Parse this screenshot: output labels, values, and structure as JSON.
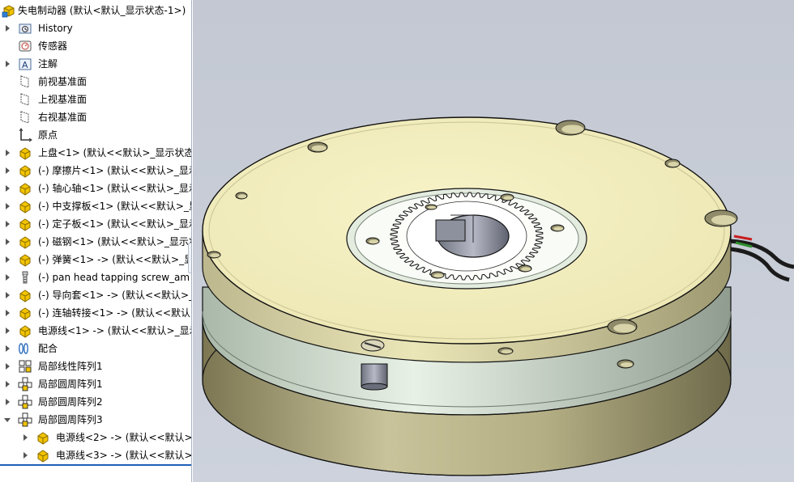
{
  "tree": {
    "root": {
      "label": "失电制动器 (默认<默认_显示状态-1>)",
      "icon": "assembly-icon"
    },
    "items": [
      {
        "label": "History",
        "icon": "history-folder-icon",
        "expander": "right",
        "indent": 0
      },
      {
        "label": "传感器",
        "icon": "sensor-icon",
        "expander": "none",
        "indent": 0
      },
      {
        "label": "注解",
        "icon": "annotation-icon",
        "expander": "right",
        "indent": 0
      },
      {
        "label": "前视基准面",
        "icon": "plane-icon",
        "expander": "none",
        "indent": 0
      },
      {
        "label": "上视基准面",
        "icon": "plane-icon",
        "expander": "none",
        "indent": 0
      },
      {
        "label": "右视基准面",
        "icon": "plane-icon",
        "expander": "none",
        "indent": 0
      },
      {
        "label": "原点",
        "icon": "origin-icon",
        "expander": "none",
        "indent": 0
      },
      {
        "label": "上盘<1> (默认<<默认>_显示状态",
        "icon": "part-icon",
        "expander": "right",
        "indent": 0
      },
      {
        "label": "(-) 摩擦片<1> (默认<<默认>_显示",
        "icon": "part-icon",
        "expander": "right",
        "indent": 0
      },
      {
        "label": "(-) 轴心轴<1> (默认<<默认>_显示",
        "icon": "part-icon",
        "expander": "right",
        "indent": 0
      },
      {
        "label": "(-) 中支撑板<1> (默认<<默认>_显",
        "icon": "part-icon",
        "expander": "right",
        "indent": 0
      },
      {
        "label": "(-) 定子板<1> (默认<<默认>_显示",
        "icon": "part-icon",
        "expander": "right",
        "indent": 0
      },
      {
        "label": "(-) 磁钢<1> (默认<<默认>_显示状",
        "icon": "part-icon",
        "expander": "right",
        "indent": 0
      },
      {
        "label": "(-) 弹簧<1> -> (默认<<默认>_显",
        "icon": "part-icon",
        "expander": "right",
        "indent": 0
      },
      {
        "label": "(-) pan head tapping screw_am",
        "icon": "screw-icon",
        "expander": "right",
        "indent": 0
      },
      {
        "label": "(-) 导向套<1> -> (默认<<默认>_显",
        "icon": "part-icon",
        "expander": "right",
        "indent": 0
      },
      {
        "label": "(-) 连轴转接<1> -> (默认<<默认>",
        "icon": "part-icon",
        "expander": "right",
        "indent": 0
      },
      {
        "label": "电源线<1> -> (默认<<默认>_显示",
        "icon": "part-icon",
        "expander": "right",
        "indent": 0
      },
      {
        "label": "配合",
        "icon": "mates-icon",
        "expander": "right",
        "indent": 0
      },
      {
        "label": "局部线性阵列1",
        "icon": "linear-pattern-icon",
        "expander": "right",
        "indent": 0
      },
      {
        "label": "局部圆周阵列1",
        "icon": "circular-pattern-icon",
        "expander": "right",
        "indent": 0
      },
      {
        "label": "局部圆周阵列2",
        "icon": "circular-pattern-icon",
        "expander": "right",
        "indent": 0
      },
      {
        "label": "局部圆周阵列3",
        "icon": "circular-pattern-icon",
        "expander": "down",
        "indent": 0
      },
      {
        "label": "电源线<2> -> (默认<<默认>_",
        "icon": "part-icon",
        "expander": "right",
        "indent": 1
      },
      {
        "label": "电源线<3> -> (默认<<默认>_",
        "icon": "part-icon",
        "expander": "right",
        "indent": 1
      }
    ]
  },
  "colors": {
    "tree_background": "#ffffff",
    "viewport_background": "#c6cbd5",
    "disc_top": "#f3efc0",
    "housing": "#b9b486",
    "friction_ring": "#e6efe4",
    "part_icon_yellow": "#f2c400",
    "selection_line": "#1f5fb8"
  }
}
